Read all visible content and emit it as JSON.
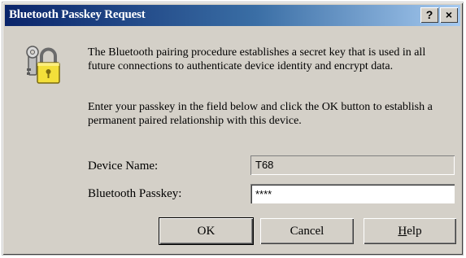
{
  "window": {
    "title": "Bluetooth Passkey Request",
    "help_glyph": "?",
    "close_glyph": "×"
  },
  "message": {
    "line1": "The Bluetooth pairing procedure establishes a secret key that is used in all future connections to authenticate device identity and encrypt data.",
    "line2": "Enter your passkey in the field below and click the OK button to establish a permanent paired relationship with this device."
  },
  "form": {
    "device_name_label": "Device Name:",
    "device_name_value": "T68",
    "passkey_label": "Bluetooth Passkey:",
    "passkey_value": "****"
  },
  "buttons": {
    "ok": "OK",
    "cancel": "Cancel",
    "help_first": "H",
    "help_rest": "elp"
  },
  "icons": {
    "main": "key-lock-icon"
  },
  "colors": {
    "title_start": "#0a246a",
    "title_end": "#a6caf0",
    "face": "#d4d0c8"
  }
}
